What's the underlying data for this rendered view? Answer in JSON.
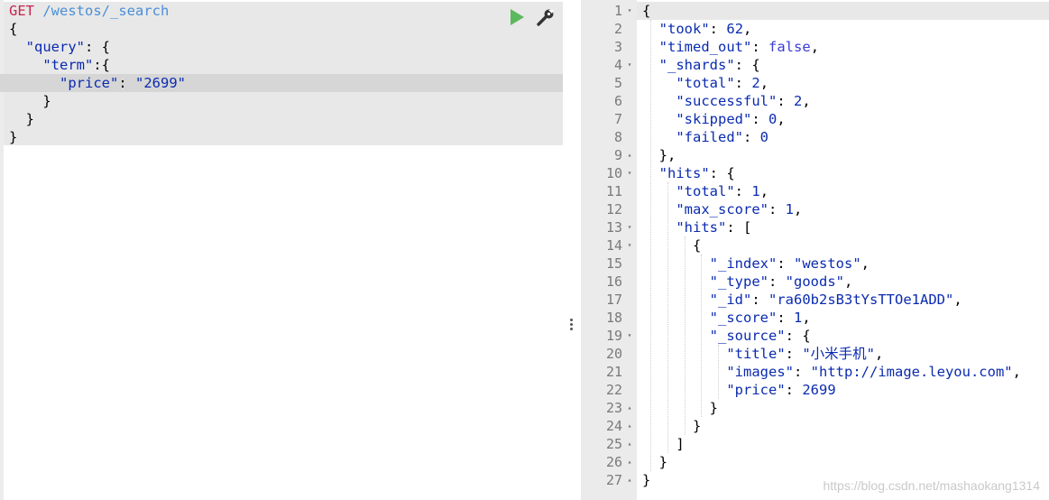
{
  "request": {
    "method": "GET",
    "path": "/westos/_search",
    "body_lines": [
      "{",
      "  \"query\": {",
      "    \"term\":{",
      "      \"price\": \"2699\"",
      "    }",
      "  }",
      "}"
    ],
    "run_icon": "play-icon",
    "settings_icon": "wrench-icon"
  },
  "splitter": {
    "icon": "vertical-ellipsis-icon"
  },
  "response": {
    "line_numbers": [
      "1",
      "2",
      "3",
      "4",
      "5",
      "6",
      "7",
      "8",
      "9",
      "10",
      "11",
      "12",
      "13",
      "14",
      "15",
      "16",
      "17",
      "18",
      "19",
      "20",
      "21",
      "22",
      "23",
      "24",
      "25",
      "26",
      "27"
    ],
    "lines": [
      "{",
      "  \"took\": 62,",
      "  \"timed_out\": false,",
      "  \"_shards\": {",
      "    \"total\": 2,",
      "    \"successful\": 2,",
      "    \"skipped\": 0,",
      "    \"failed\": 0",
      "  },",
      "  \"hits\": {",
      "    \"total\": 1,",
      "    \"max_score\": 1,",
      "    \"hits\": [",
      "      {",
      "        \"_index\": \"westos\",",
      "        \"_type\": \"goods\",",
      "        \"_id\": \"ra60b2sB3tYsTTOe1ADD\",",
      "        \"_score\": 1,",
      "        \"_source\": {",
      "          \"title\": \"小米手机\",",
      "          \"images\": \"http://image.leyou.com\",",
      "          \"price\": 2699",
      "        }",
      "      }",
      "    ]",
      "  }",
      "}"
    ],
    "fold_markers": {
      "1": "▾",
      "4": "▾",
      "9": "▴",
      "10": "▾",
      "13": "▾",
      "14": "▾",
      "19": "▾",
      "23": "▴",
      "24": "▴",
      "25": "▴",
      "26": "▴",
      "27": "▴"
    }
  },
  "watermark": "https://blog.csdn.net/mashaokang1314",
  "colors": {
    "method": "#c7254e",
    "path": "#4a8fd8",
    "key": "#0b2bb0",
    "run": "#5cb85c",
    "editor_bg": "#e8e8e8",
    "active_line": "#d6d6d6",
    "gutter": "#ebebeb"
  }
}
